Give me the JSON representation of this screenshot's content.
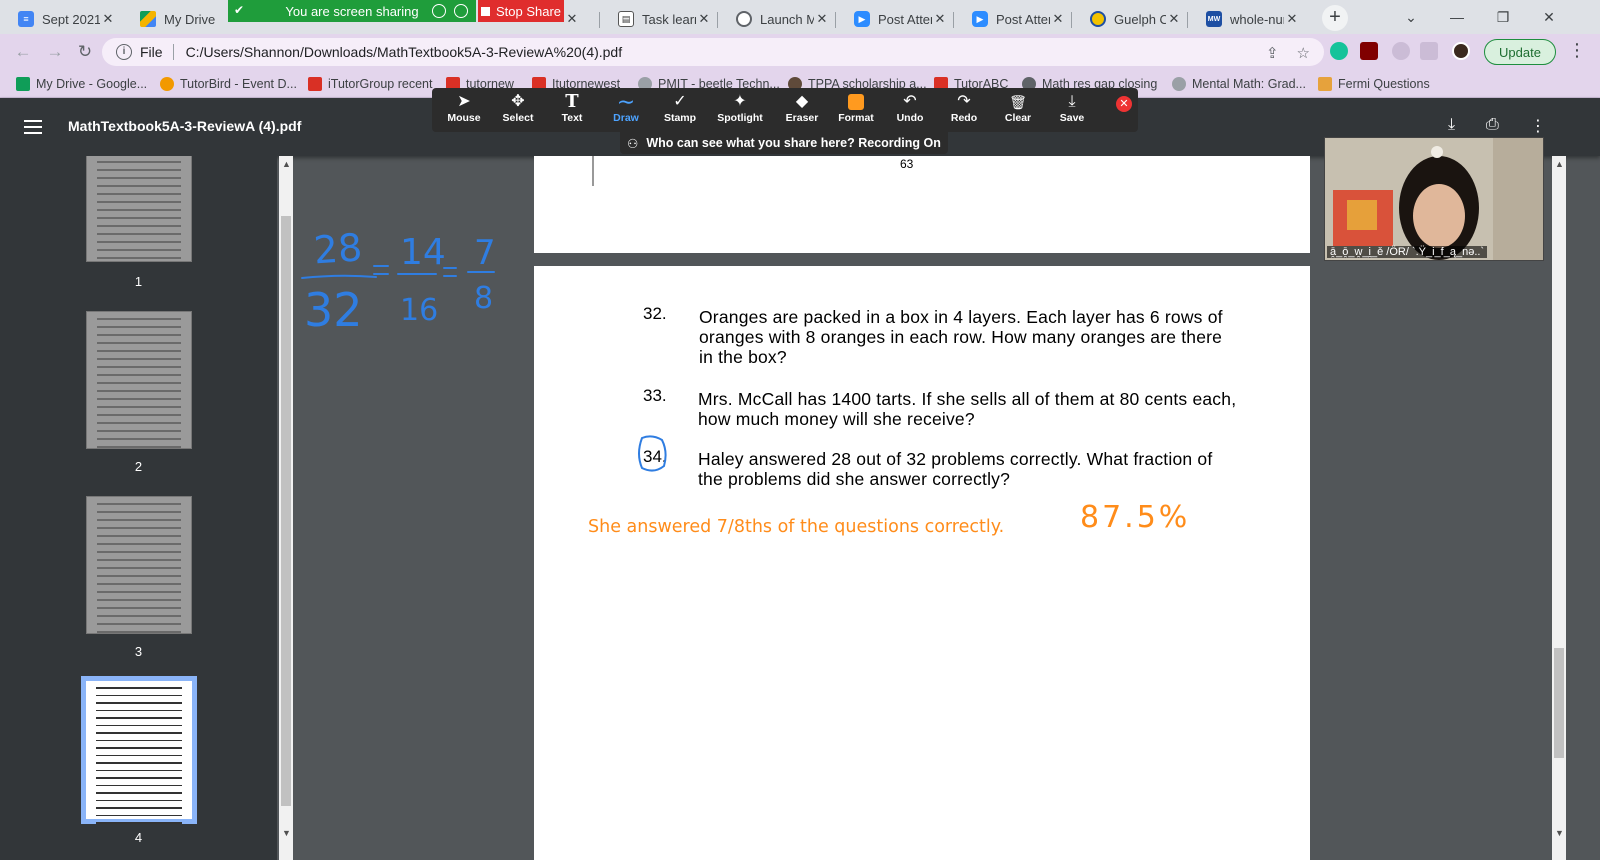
{
  "tabs": [
    {
      "title": "Sept 2021",
      "color": "#4285f4",
      "icon": "docs-icon"
    },
    {
      "title": "My Drive",
      "color": "#0f9d58",
      "icon": "drive-icon"
    },
    {
      "title": "",
      "color": "#1a73e8",
      "icon": "tab-icon"
    },
    {
      "title": "Task learni",
      "color": "#555555",
      "icon": "task-icon"
    },
    {
      "title": "Launch Me",
      "color": "#5f6368",
      "icon": "globe-icon"
    },
    {
      "title": "Post Atten",
      "color": "#2d8cff",
      "icon": "zoom-icon"
    },
    {
      "title": "Post Atten",
      "color": "#2d8cff",
      "icon": "zoom-icon"
    },
    {
      "title": "Guelph O",
      "color": "#f2c200",
      "icon": "guelph-icon"
    },
    {
      "title": "whole-nur",
      "color": "#1e4fa3",
      "icon": "mw-icon"
    }
  ],
  "share": {
    "banner": "You are screen sharing",
    "stop_label": "Stop Share"
  },
  "address": {
    "scheme_label": "File",
    "url": "C:/Users/Shannon/Downloads/MathTextbook5A-3-ReviewA%20(4).pdf"
  },
  "update_label": "Update",
  "bookmarks": [
    {
      "label": "My Drive - Google...",
      "color": "#0f9d58"
    },
    {
      "label": "TutorBird - Event D...",
      "color": "#f29900"
    },
    {
      "label": "iTutorGroup recent",
      "color": "#d93025"
    },
    {
      "label": "tutornew",
      "color": "#d93025"
    },
    {
      "label": "Itutornewest",
      "color": "#d93025"
    },
    {
      "label": "PMIT - beetle Techn...",
      "color": "#9aa0a6"
    },
    {
      "label": "TPPA scholarship a...",
      "color": "#5f4a3a"
    },
    {
      "label": "TutorABC",
      "color": "#d93025"
    },
    {
      "label": "Math res gap closing",
      "color": "#5f6368"
    },
    {
      "label": "Mental Math: Grad...",
      "color": "#9aa0a6"
    },
    {
      "label": "Fermi Questions",
      "color": "#e6a23c"
    }
  ],
  "annotation_tools": [
    {
      "label": "Mouse",
      "glyph": "➤"
    },
    {
      "label": "Select",
      "glyph": "✥"
    },
    {
      "label": "Text",
      "glyph": "T"
    },
    {
      "label": "Draw",
      "glyph": "∼"
    },
    {
      "label": "Stamp",
      "glyph": "✓"
    },
    {
      "label": "Spotlight",
      "glyph": "✦"
    },
    {
      "label": "Eraser",
      "glyph": "◆"
    },
    {
      "label": "Format",
      "glyph": ""
    },
    {
      "label": "Undo",
      "glyph": "↶"
    },
    {
      "label": "Redo",
      "glyph": "↷"
    },
    {
      "label": "Clear",
      "glyph": "🗑"
    },
    {
      "label": "Save",
      "glyph": "⤓"
    }
  ],
  "active_tool": "Draw",
  "recording_notice": "Who can see what you share here? Recording On",
  "pdf": {
    "title": "MathTextbook5A-3-ReviewA (4).pdf",
    "page_number_shown": "63"
  },
  "thumbnails": [
    "1",
    "2",
    "3",
    "4"
  ],
  "selected_thumbnail": "4",
  "handwriting": {
    "n1": "28",
    "d1": "32",
    "n2": "14",
    "d2": "16",
    "n3": "7",
    "d3": "8"
  },
  "questions": [
    {
      "num": "32.",
      "lines": [
        "Oranges are packed in a box in 4 layers. Each layer has 6 rows of",
        "oranges with 8 oranges in each row. How many oranges are there",
        "in the box?"
      ]
    },
    {
      "num": "33.",
      "lines": [
        "Mrs. McCall has 1400 tarts. If she sells all of them at 80 cents each,",
        "how much money will she receive?"
      ]
    },
    {
      "num": "34.",
      "lines": [
        "Haley answered 28 out of 32 problems correctly. What fraction of",
        "the problems did she answer correctly?"
      ]
    }
  ],
  "answer_text": "She answered 7/8ths of the questions correctly.",
  "percent_text": "87.5%",
  "video_caption": "ā̯_ō̯_w̯_i̯_ě /ÖR/ `.Ÿ_i_f_ą_nə..`",
  "colors": {
    "ink_blue": "#2f7de1",
    "ink_orange": "#ff8c1a",
    "share_green": "#1f9d3b",
    "stop_red": "#e02d2d"
  }
}
